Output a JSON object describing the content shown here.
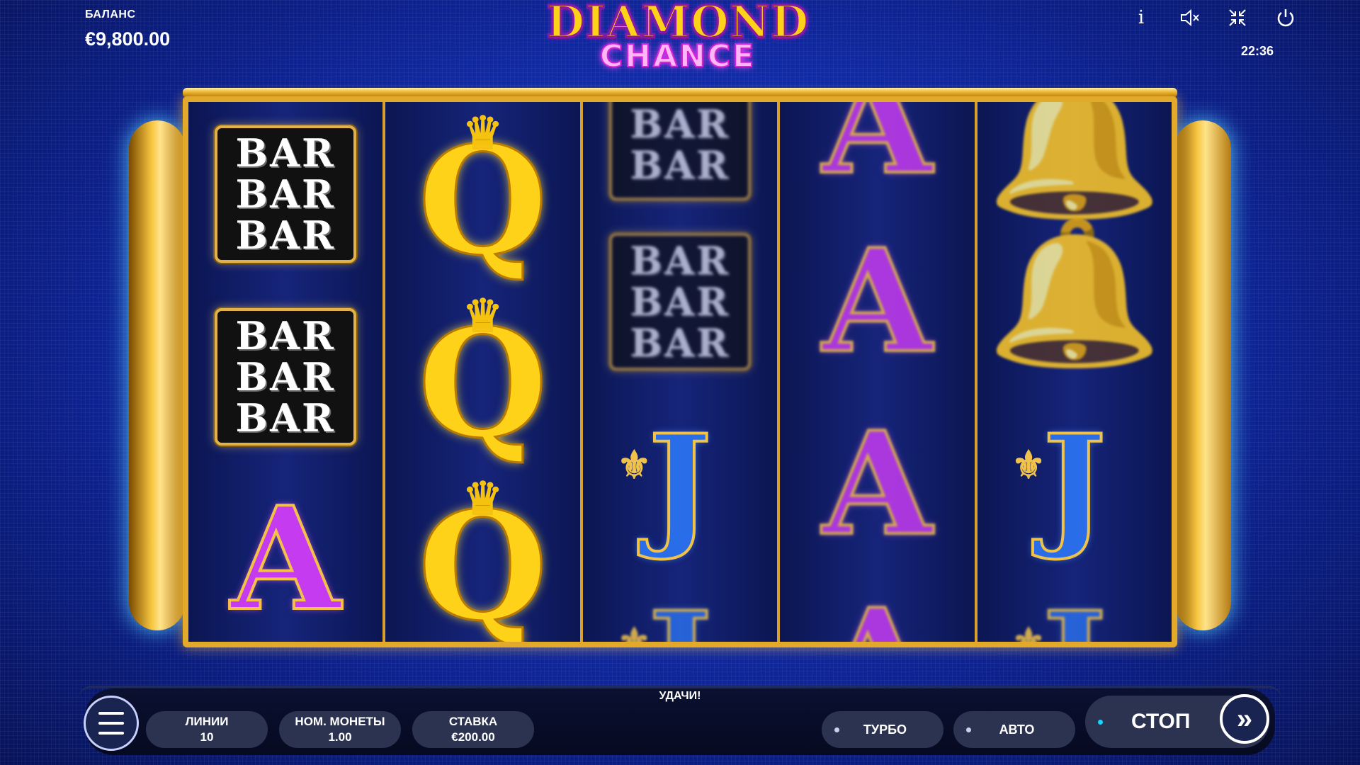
{
  "balance": {
    "label": "БАЛАНС",
    "value": "€9,800.00"
  },
  "logo": {
    "line1": "DIAMOND",
    "line2": "CHANCE"
  },
  "top_icons": [
    "info-icon",
    "sound-muted-icon",
    "exit-fullscreen-icon",
    "power-icon"
  ],
  "clock": "22:36",
  "reels": [
    [
      "BAR BAR BAR",
      "BAR BAR BAR",
      "A"
    ],
    [
      "Q",
      "Q",
      "Q"
    ],
    [
      "BAR BAR",
      "BAR BAR BAR",
      "J",
      "J"
    ],
    [
      "A",
      "A",
      "A",
      "A"
    ],
    [
      "bell",
      "bell",
      "J",
      "J"
    ]
  ],
  "symbols": {
    "bar": "BAR",
    "a": "A",
    "q": "Q",
    "j": "J",
    "bell": "🔔",
    "crown": "♛",
    "fleur": "⚜"
  },
  "message": "УДАЧИ!",
  "controls": {
    "lines": {
      "label": "ЛИНИИ",
      "value": "10"
    },
    "coin": {
      "label": "НОМ. МОНЕТЫ",
      "value": "1.00"
    },
    "bet": {
      "label": "СТАВКА",
      "value": "€200.00"
    },
    "turbo": "ТУРБО",
    "auto": "АВТО",
    "stop": "СТОП",
    "fast_forward": "»"
  },
  "colors": {
    "background": "#1330b8",
    "gold": "#e3a92a",
    "stop_dot": "#18d4ff"
  }
}
